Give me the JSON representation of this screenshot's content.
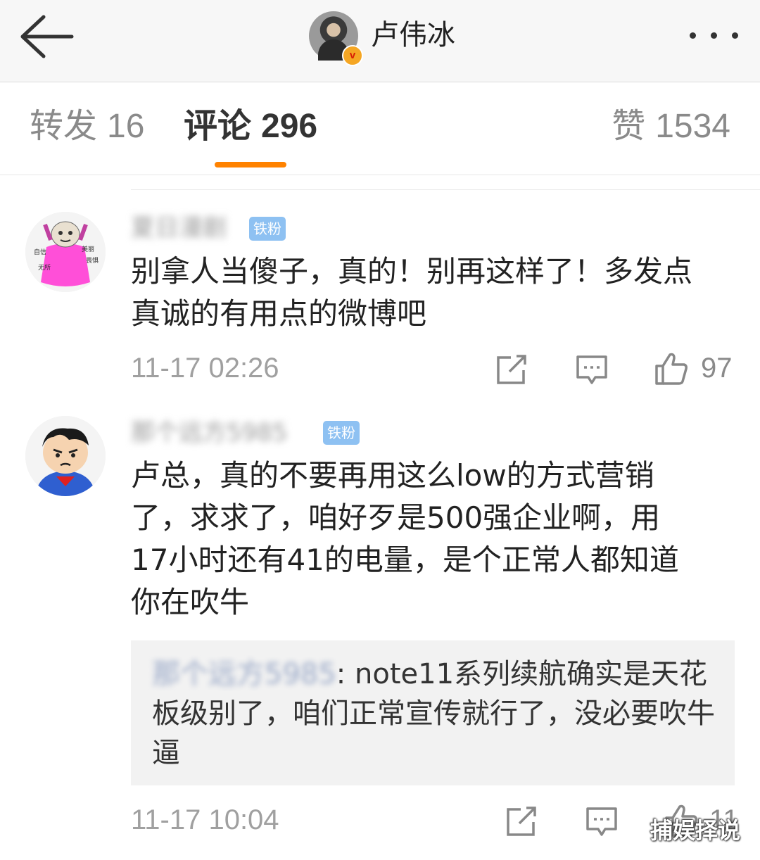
{
  "header": {
    "title": "卢伟冰",
    "verified_badge": "v"
  },
  "tabs": {
    "repost_label": "转发",
    "repost_count": "16",
    "comment_label": "评论",
    "comment_count": "296",
    "like_label": "赞",
    "like_count": "1534",
    "active": "comment",
    "accent_color": "#ff8200"
  },
  "comments": [
    {
      "username": "夏日漫剧",
      "badge": "铁粉",
      "text_lines": [
        "别拿人当傻子，真的！别再这样了！多发点",
        "真诚的有用点的微博吧"
      ],
      "time": "11-17 02:26",
      "likes": "97",
      "avatar_labels": [
        "自信",
        "美丽",
        "无所",
        "畏惧"
      ]
    },
    {
      "username": "那个远方5985",
      "badge": "铁粉",
      "text_lines": [
        "卢总，真的不要再用这么low的方式营销",
        "了，求求了，咱好歹是500强企业啊，用",
        "17小时还有41的电量，是个正常人都知道",
        "你在吹牛"
      ],
      "reply": {
        "username": "那个远方5985",
        "separator": ": ",
        "lines": [
          "note11系列续航确实是天花",
          "板级别了，咱们正常宣传就行了，没必要吹牛",
          "逼"
        ]
      },
      "time": "11-17 10:04",
      "likes": "11"
    }
  ],
  "icons": {
    "back": "back-arrow-icon",
    "more": "more-dots-icon",
    "repost": "repost-icon",
    "comment": "comment-icon",
    "like": "thumbs-up-icon"
  },
  "watermark": "捕娱择说"
}
